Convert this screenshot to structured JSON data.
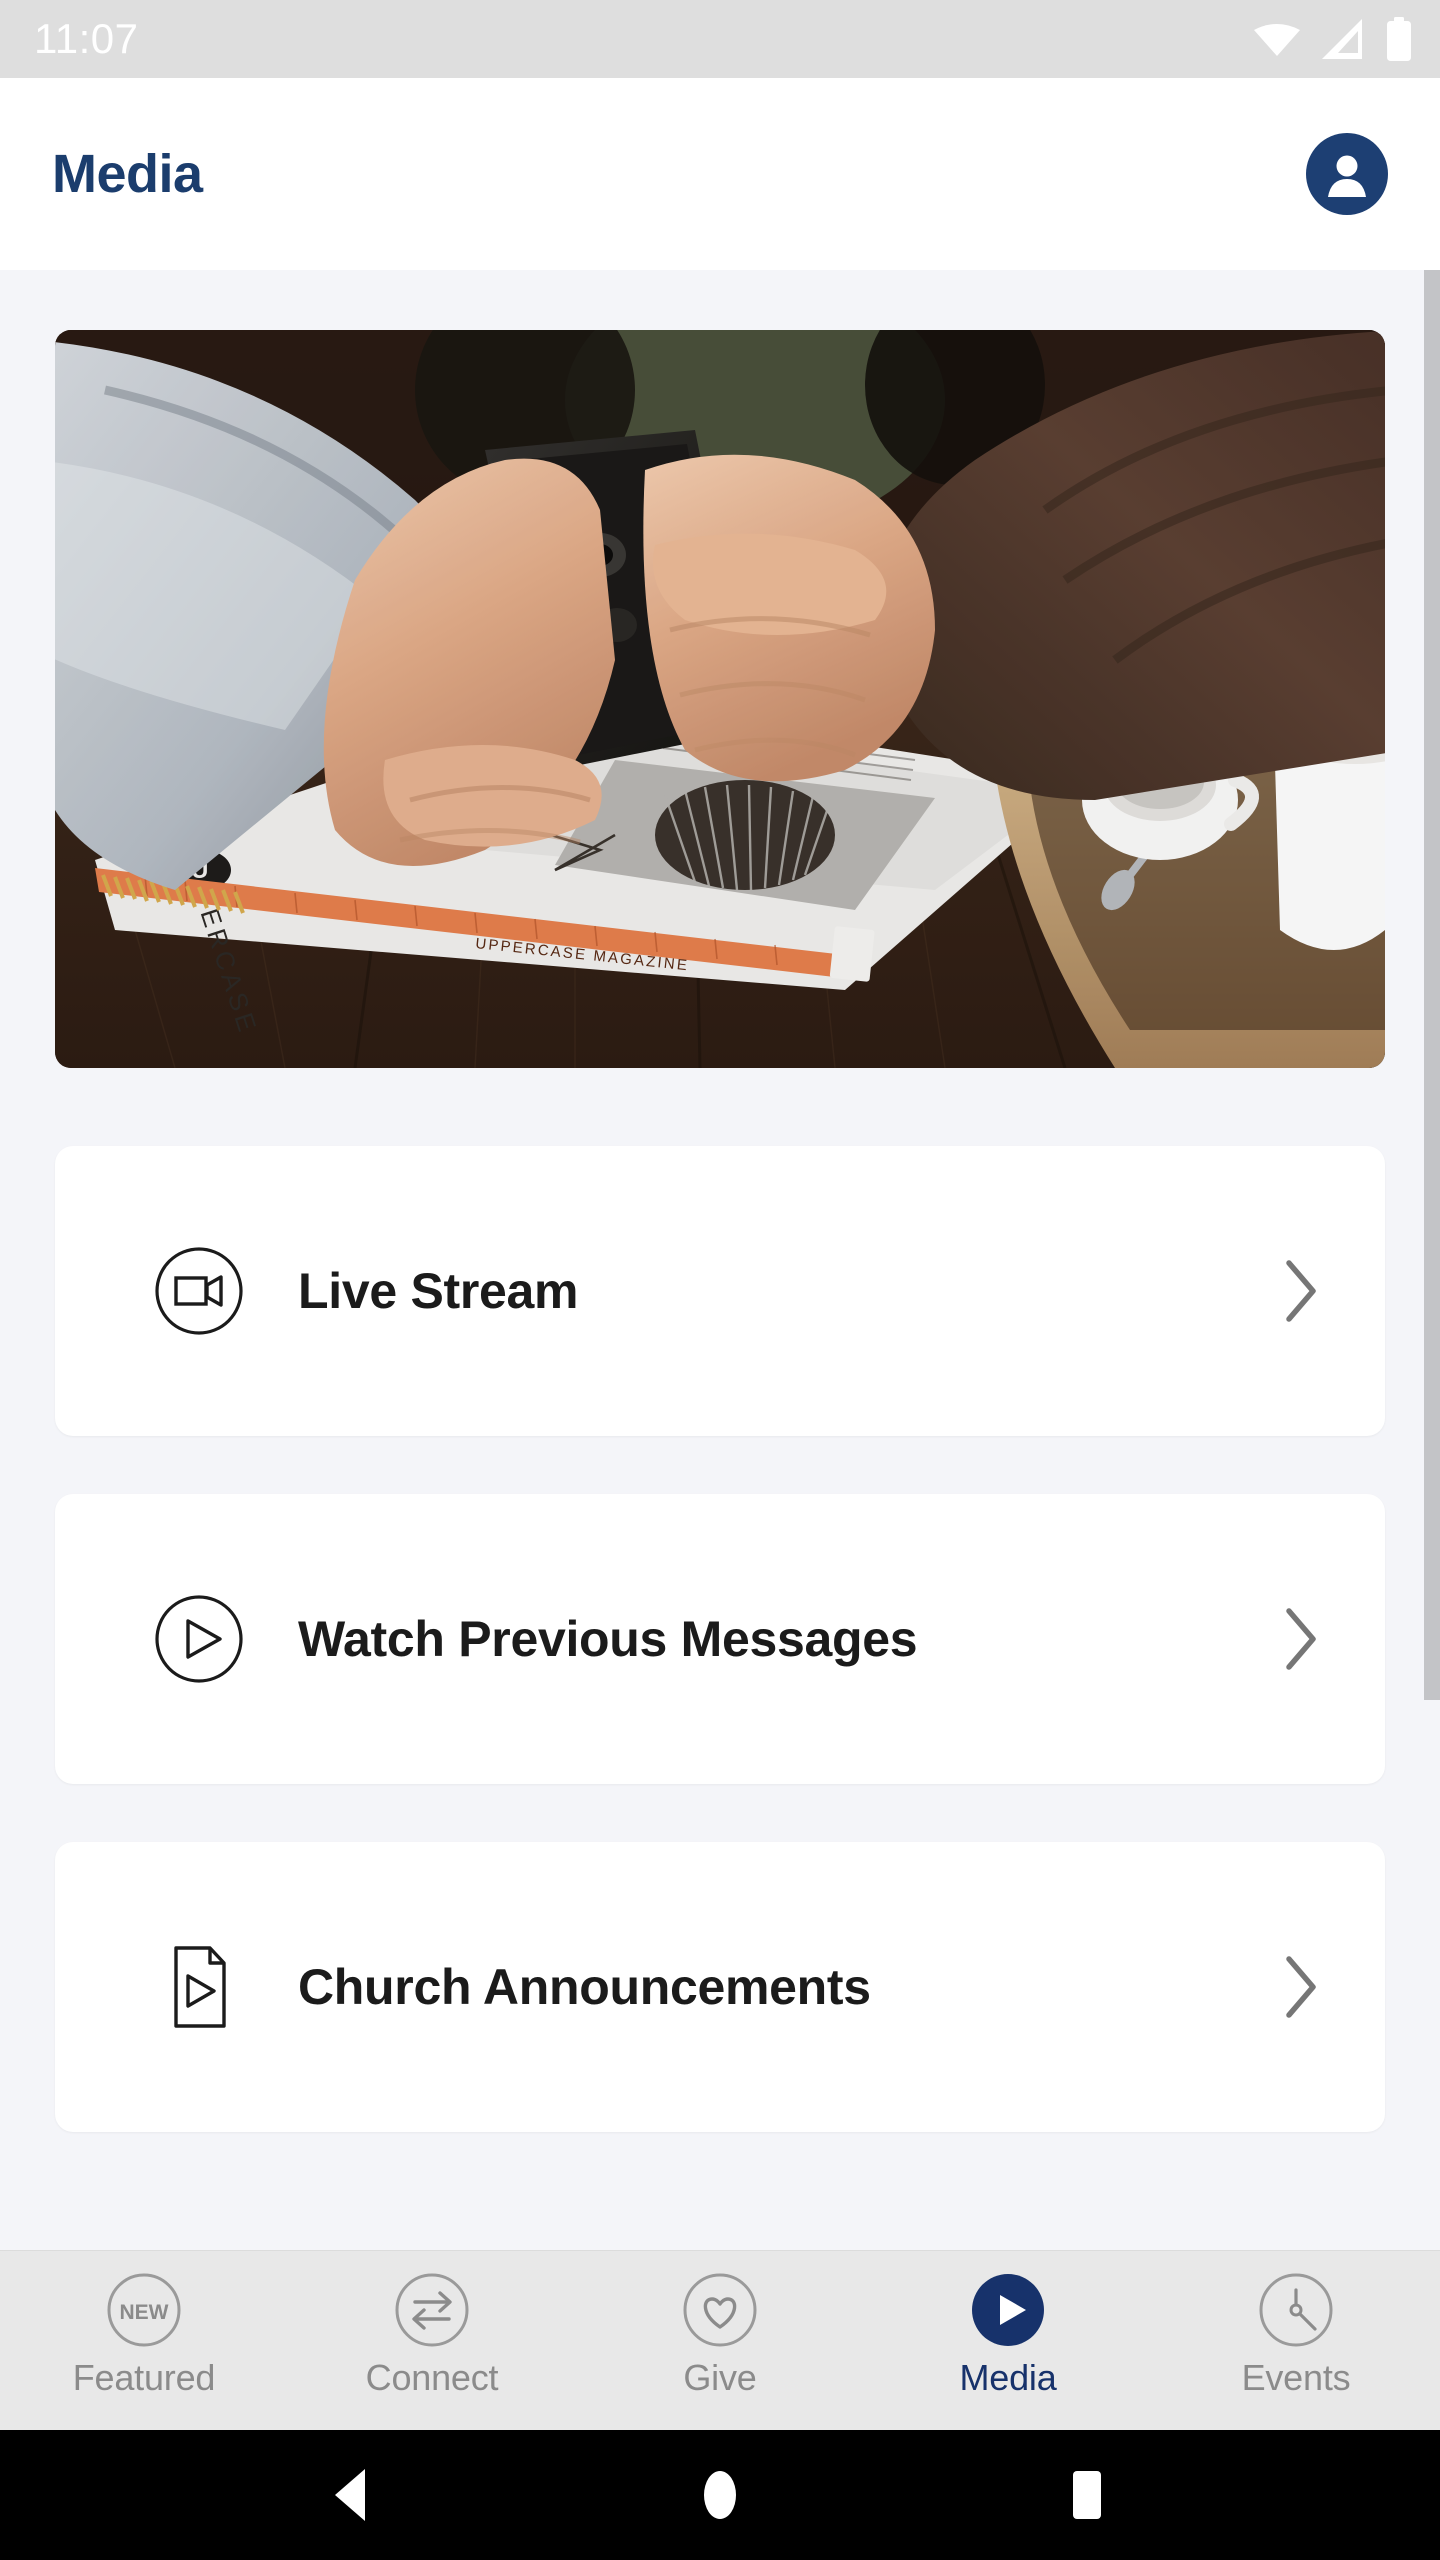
{
  "status_bar": {
    "time": "11:07",
    "icons": [
      {
        "name": "wifi-icon",
        "label": "WiFi"
      },
      {
        "name": "cellular-signal-icon",
        "label": "Cellular signal"
      },
      {
        "name": "battery-icon",
        "label": "Battery"
      }
    ]
  },
  "header": {
    "title": "Media",
    "avatar_name": "account-avatar"
  },
  "hero": {
    "alt": "Hands holding a smartphone above an Uppercase magazine on a dark wooden table with coffee cups",
    "magazine_text": "UPPERCASE MAGAZINE"
  },
  "menu": {
    "items": [
      {
        "label": "Live Stream",
        "icon": "video-camera-icon",
        "chevron": "chevron-right-icon"
      },
      {
        "label": "Watch Previous Messages",
        "icon": "play-circle-icon",
        "chevron": "chevron-right-icon"
      },
      {
        "label": "Church Announcements",
        "icon": "document-play-icon",
        "chevron": "chevron-right-icon"
      }
    ]
  },
  "tabbar": {
    "active_index": 3,
    "tabs": [
      {
        "label": "Featured",
        "icon": "new-badge-icon",
        "badge_text": "NEW"
      },
      {
        "label": "Connect",
        "icon": "exchange-arrows-icon"
      },
      {
        "label": "Give",
        "icon": "heart-icon"
      },
      {
        "label": "Media",
        "icon": "play-filled-icon"
      },
      {
        "label": "Events",
        "icon": "clock-icon"
      }
    ]
  },
  "android_nav": {
    "buttons": [
      {
        "name": "back-button",
        "icon": "triangle-left-icon"
      },
      {
        "name": "home-button",
        "icon": "circle-icon"
      },
      {
        "name": "recents-button",
        "icon": "square-icon"
      }
    ]
  },
  "colors": {
    "brand_navy": "#1b3d6d",
    "tab_active": "#17326b",
    "tab_inactive": "#8b8b8b",
    "page_bg": "#f4f5f9",
    "card_bg": "#ffffff",
    "status_bar_bg": "#dedede",
    "tabbar_bg": "#e8e8e8"
  }
}
